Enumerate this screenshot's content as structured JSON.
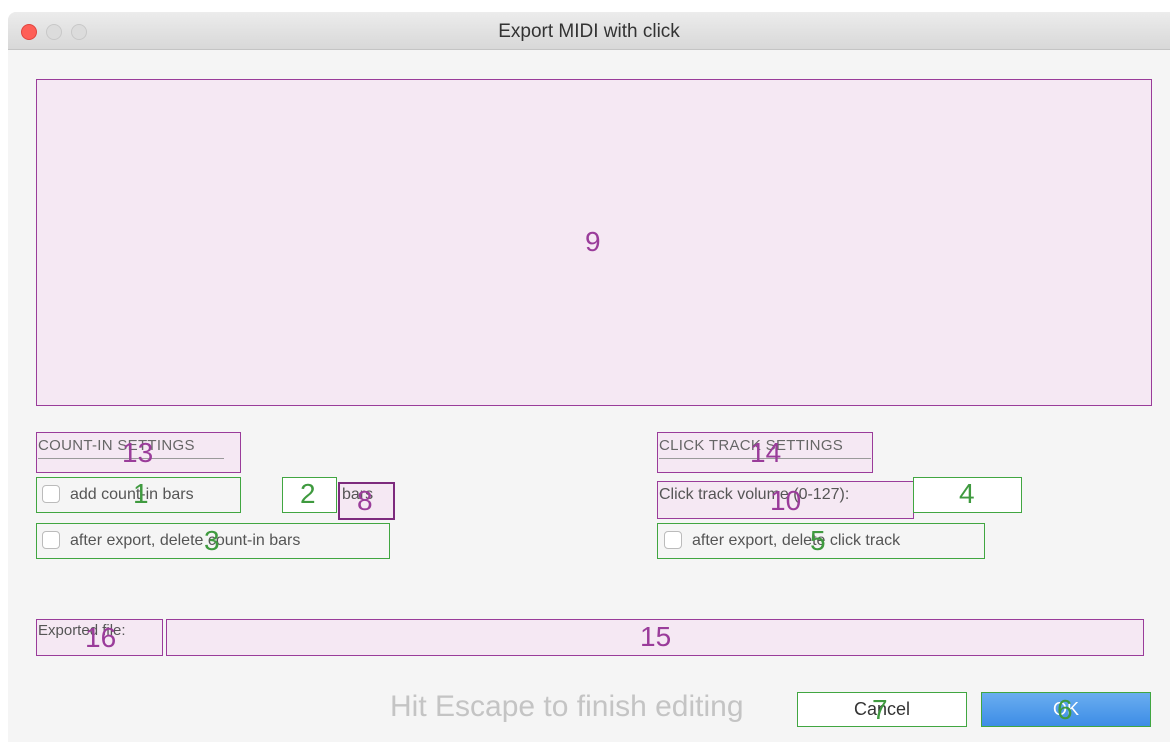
{
  "window": {
    "title": "Export MIDI with click"
  },
  "preview_panel": {
    "marker": "9"
  },
  "count_in": {
    "section_title": "COUNT-IN SETTINGS",
    "section_marker": "13",
    "add_count_in_label": "add count-in bars",
    "add_count_in_marker": "1",
    "add_count_in_checked": false,
    "bars_value": "",
    "bars_marker": "2",
    "bars_unit": "bars",
    "bars_unit_marker": "8",
    "delete_after_label": "after export, delete count-in bars",
    "delete_after_marker": "3",
    "delete_after_checked": false
  },
  "click_track": {
    "section_title": "CLICK TRACK SETTINGS",
    "section_marker": "14",
    "volume_label": "Click track volume (0-127):",
    "volume_label_marker": "10",
    "volume_value": "",
    "volume_marker": "4",
    "delete_after_label": "after export, delete click track",
    "delete_after_marker": "5",
    "delete_after_checked": false
  },
  "export": {
    "file_label": "Exported file:",
    "file_label_marker": "16",
    "file_value": "",
    "file_marker": "15"
  },
  "footer": {
    "hint": "Hit Escape to finish editing",
    "cancel_label": "Cancel",
    "cancel_marker": "7",
    "ok_label": "OK",
    "ok_marker": "6"
  },
  "colors": {
    "close_button": "#fe5f57",
    "annotation_purple": "#9a3c9a",
    "annotation_green": "#41a641",
    "ok_button": "#3d8de6"
  }
}
